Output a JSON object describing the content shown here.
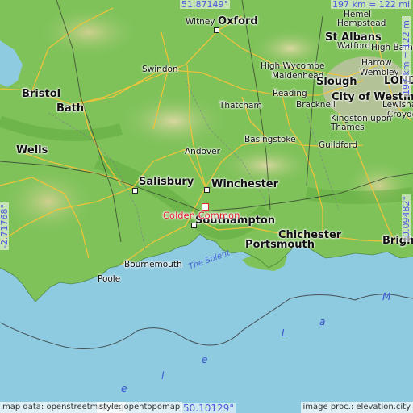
{
  "coords": {
    "top": "51.87149°",
    "bottom": "50.10129°",
    "left": "-2.71768°",
    "right": "-0.09482°",
    "scale_h": "197 km = 122 mi",
    "scale_v": "197 km = 122 mi"
  },
  "place": "Colden Common",
  "cities": [
    {
      "name": "Hemel"
    },
    {
      "name": "Hempstead"
    },
    {
      "name": "Witney"
    },
    {
      "name": "Oxford"
    },
    {
      "name": "St Albans"
    },
    {
      "name": "Watford"
    },
    {
      "name": "High Barnet"
    },
    {
      "name": "Harrow"
    },
    {
      "name": "Wembley"
    },
    {
      "name": "High Wycombe"
    },
    {
      "name": "Maidenhead"
    },
    {
      "name": "Slough"
    },
    {
      "name": "LONDON"
    },
    {
      "name": "Swindon"
    },
    {
      "name": "Bristol"
    },
    {
      "name": "Reading"
    },
    {
      "name": "City of Westminster"
    },
    {
      "name": "Bath"
    },
    {
      "name": "Thatcham"
    },
    {
      "name": "Bracknell"
    },
    {
      "name": "Lewisham"
    },
    {
      "name": "Croydon"
    },
    {
      "name": "Kingston upon Thames"
    },
    {
      "name": "Basingstoke"
    },
    {
      "name": "Wells"
    },
    {
      "name": "Andover"
    },
    {
      "name": "Guildford"
    },
    {
      "name": "Salisbury"
    },
    {
      "name": "Winchester"
    },
    {
      "name": "Southampton"
    },
    {
      "name": "Chichester"
    },
    {
      "name": "Portsmouth"
    },
    {
      "name": "Brighton"
    },
    {
      "name": "Bournemouth"
    },
    {
      "name": "Poole"
    }
  ],
  "water": {
    "solent": "The Solent",
    "channel_letters": [
      "M",
      "a",
      "L",
      "e",
      "l",
      "e"
    ]
  },
  "footer": {
    "left": "map data: openstreetmap.org",
    "style": "style: opentopomap",
    "right": "image proc.: elevation.city"
  },
  "colors": {
    "sea": "#8fcbe0",
    "land": "#7fc25a",
    "highlight": "#e0222a",
    "coord_text": "#4a5ae0"
  }
}
